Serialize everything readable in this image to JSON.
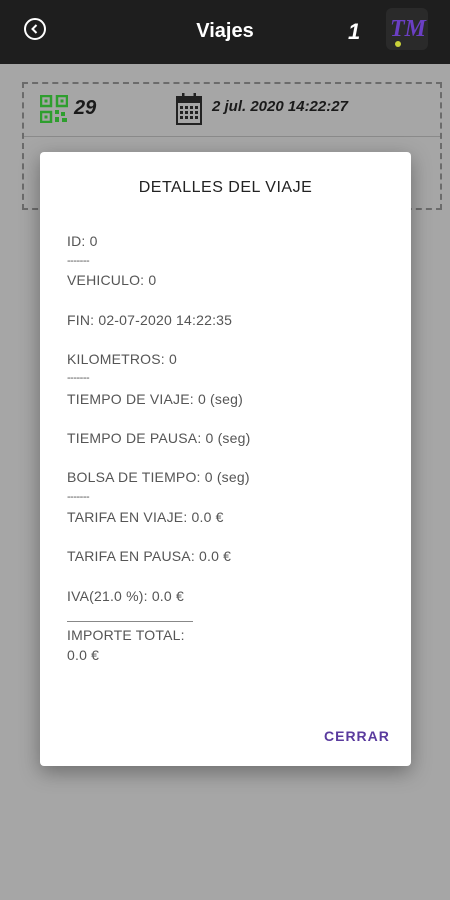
{
  "app": {
    "title": "Viajes",
    "count": "1",
    "logo": "tm-logo"
  },
  "trip": {
    "number": "29",
    "date": "2 jul. 2020 14:22:27"
  },
  "dialog": {
    "title": "DETALLES DEL VIAJE",
    "id": "ID: 0",
    "vehiculo": "VEHICULO: 0",
    "fin": "FIN: 02-07-2020 14:22:35",
    "kilometros": "KILOMETROS: 0",
    "tiempo_viaje": "TIEMPO DE VIAJE: 0 (seg)",
    "tiempo_pausa": "TIEMPO DE PAUSA: 0 (seg)",
    "bolsa_tiempo": "BOLSA DE TIEMPO: 0 (seg)",
    "tarifa_viaje": "TARIFA EN VIAJE:  0.0 €",
    "tarifa_pausa": "TARIFA EN PAUSA: 0.0 €",
    "iva": "IVA(21.0 %): 0.0 €",
    "importe_label": "IMPORTE TOTAL:",
    "importe_value": "0.0 €",
    "separator": "-------",
    "close_label": "CERRAR"
  },
  "colors": {
    "appbar": "#1e1e1e",
    "overlay": "#a6a6a6",
    "accent": "#5a3b9e",
    "qr": "#2e9e2e"
  }
}
